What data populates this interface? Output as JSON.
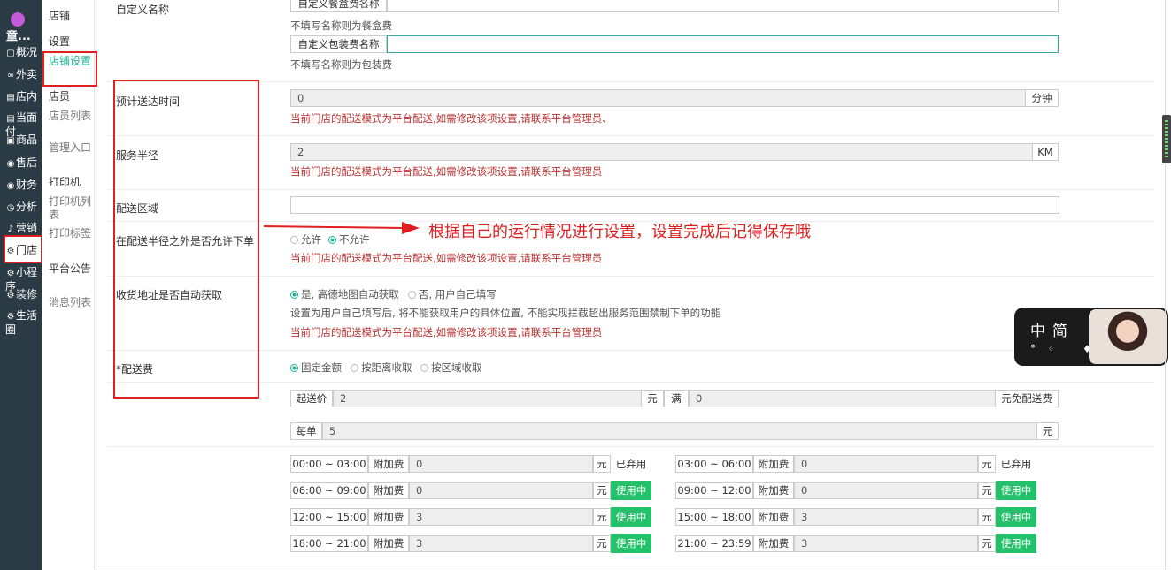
{
  "brand": "童...",
  "nav1": [
    {
      "label": "概况",
      "icon": "▢"
    },
    {
      "label": "外卖",
      "icon": "∞"
    },
    {
      "label": "店内",
      "icon": "▤"
    },
    {
      "label": "当面付",
      "icon": "▤"
    },
    {
      "label": "商品",
      "icon": "▣"
    },
    {
      "label": "售后",
      "icon": "◉"
    },
    {
      "label": "财务",
      "icon": "◉"
    },
    {
      "label": "分析",
      "icon": "◷"
    },
    {
      "label": "营销",
      "icon": "♪"
    },
    {
      "label": "门店",
      "icon": "⚙"
    },
    {
      "label": "小程序",
      "icon": "⚙"
    },
    {
      "label": "装修",
      "icon": "⚙"
    },
    {
      "label": "生活圈",
      "icon": "⚙"
    }
  ],
  "nav2": {
    "section": "店铺",
    "setting": "设置",
    "store_setting": "店铺设置",
    "staff": "店员",
    "staff_list": "店员列表",
    "manage": "管理入口",
    "printer": "打印机",
    "printer_list": "打印机列表",
    "print_label": "打印标签",
    "notice": "平台公告",
    "msg_list": "消息列表"
  },
  "form": {
    "custom_name_label": "自定义名称",
    "box_name_placeholder": "自定义餐盒费名称",
    "box_hint": "不填写名称则为餐盒费",
    "pack_name_addon": "自定义包装费名称",
    "pack_hint": "不填写名称则为包装费",
    "eta_label": "预计送达时间",
    "eta_value": "0",
    "eta_unit": "分钟",
    "warn1": "当前门店的配送模式为平台配送,如需修改该项设置,请联系平台管理员、",
    "warn2": "当前门店的配送模式为平台配送,如需修改该项设置,请联系平台管理员",
    "radius_label": "服务半径",
    "radius_value": "2",
    "radius_unit": "KM",
    "area_label": "配送区域",
    "outside_label": "在配送半径之外是否允许下单",
    "allow": "允许",
    "deny": "不允许",
    "auto_label": "收货地址是否自动获取",
    "auto_yes": "是, 高德地图自动获取",
    "auto_no": "否, 用户自己填写",
    "auto_hint": "设置为用户自己填写后, 将不能获取用户的具体位置, 不能实现拦截超出服务范围禁制下单的功能",
    "fee_label": "*配送费",
    "fee_fixed": "固定金额",
    "fee_distance": "按距离收取",
    "fee_area": "按区域收取",
    "min_label": "起送价",
    "min_value": "2",
    "yuan": "元",
    "full": "满",
    "full_value": "0",
    "free_label": "元免配送费",
    "per_label": "每单",
    "per_value": "5",
    "surcharge": "附加费",
    "disabled": "已弃用",
    "active": "使用中",
    "slots": [
      {
        "time": "00:00 ~ 03:00",
        "value": "0",
        "status": "已弃用",
        "on": false
      },
      {
        "time": "03:00 ~ 06:00",
        "value": "0",
        "status": "已弃用",
        "on": false
      },
      {
        "time": "06:00 ~ 09:00",
        "value": "0",
        "status": "使用中",
        "on": true
      },
      {
        "time": "09:00 ~ 12:00",
        "value": "0",
        "status": "使用中",
        "on": true
      },
      {
        "time": "12:00 ~ 15:00",
        "value": "3",
        "status": "使用中",
        "on": true
      },
      {
        "time": "15:00 ~ 18:00",
        "value": "3",
        "status": "使用中",
        "on": true
      },
      {
        "time": "18:00 ~ 21:00",
        "value": "3",
        "status": "使用中",
        "on": true
      },
      {
        "time": "21:00 ~ 23:59",
        "value": "3",
        "status": "使用中",
        "on": true
      }
    ]
  },
  "annotation": "根据自己的运行情况进行设置，设置完成后记得保存哦",
  "widget": {
    "title": "中简",
    "icons": "°◦ ♦"
  },
  "colors": {
    "accent": "#1ab394",
    "active_tag": "#23c26a",
    "warn": "#b8312f",
    "annot": "#e02020"
  }
}
